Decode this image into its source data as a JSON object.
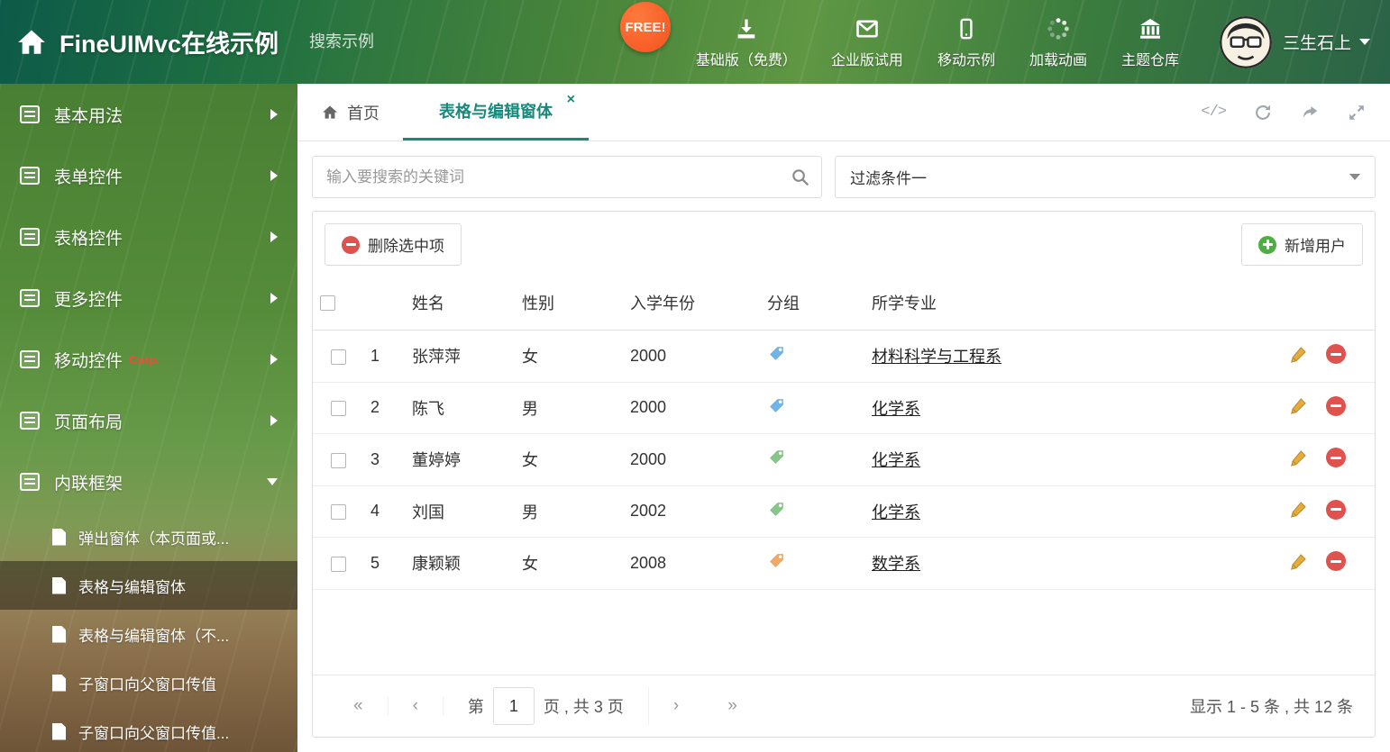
{
  "colors": {
    "accent_teal": "#18897a",
    "header_green": "#3a7b3e",
    "tag_blue": "#6fb5e8",
    "tag_green": "#85c785",
    "tag_orange": "#f2a963",
    "danger_red": "#e0524e",
    "success_green": "#4fae41",
    "free_badge_orange": "#f4511e"
  },
  "header": {
    "title": "FineUIMvc在线示例",
    "search_placeholder": "搜索示例",
    "free_badge": "FREE!",
    "nav": [
      {
        "icon": "download-icon",
        "label": "基础版（免费）"
      },
      {
        "icon": "mail-icon",
        "label": "企业版试用"
      },
      {
        "icon": "mobile-icon",
        "label": "移动示例"
      },
      {
        "icon": "spinner-icon",
        "label": "加载动画"
      },
      {
        "icon": "bank-icon",
        "label": "主题仓库"
      }
    ],
    "user_name": "三生石上"
  },
  "sidebar": {
    "items": [
      {
        "label": "基本用法",
        "icon": "home-icon",
        "state": "collapsed",
        "badge": ""
      },
      {
        "label": "表单控件",
        "icon": "form-icon",
        "state": "collapsed",
        "badge": ""
      },
      {
        "label": "表格控件",
        "icon": "grid-icon",
        "state": "collapsed",
        "badge": ""
      },
      {
        "label": "更多控件",
        "icon": "widgets-icon",
        "state": "collapsed",
        "badge": ""
      },
      {
        "label": "移动控件",
        "icon": "mobile-icon",
        "state": "collapsed",
        "badge": "Corp."
      },
      {
        "label": "页面布局",
        "icon": "layout-icon",
        "state": "collapsed",
        "badge": ""
      },
      {
        "label": "内联框架",
        "icon": "iframe-icon",
        "state": "expanded",
        "badge": ""
      }
    ],
    "subitems": [
      {
        "label": "弹出窗体（本页面或...",
        "state": "normal"
      },
      {
        "label": "表格与编辑窗体",
        "state": "active"
      },
      {
        "label": "表格与编辑窗体（不...",
        "state": "normal"
      },
      {
        "label": "子窗口向父窗口传值",
        "state": "normal"
      },
      {
        "label": "子窗口向父窗口传值...",
        "state": "normal"
      }
    ]
  },
  "tabs": {
    "home_label": "首页",
    "active_label": "表格与编辑窗体",
    "close_glyph": "×"
  },
  "filter_bar": {
    "search_placeholder": "输入要搜索的关键词",
    "filter_selected": "过滤条件一"
  },
  "toolbar": {
    "delete_label": "删除选中项",
    "add_label": "新增用户"
  },
  "table": {
    "headers": {
      "name": "姓名",
      "gender": "性别",
      "year": "入学年份",
      "group": "分组",
      "major": "所学专业"
    },
    "rows": [
      {
        "index": "1",
        "name": "张萍萍",
        "gender": "女",
        "year": "2000",
        "tag": "tag-blue",
        "major": "材料科学与工程系"
      },
      {
        "index": "2",
        "name": "陈飞",
        "gender": "男",
        "year": "2000",
        "tag": "tag-blue",
        "major": "化学系"
      },
      {
        "index": "3",
        "name": "董婷婷",
        "gender": "女",
        "year": "2000",
        "tag": "tag-green",
        "major": "化学系"
      },
      {
        "index": "4",
        "name": "刘国",
        "gender": "男",
        "year": "2002",
        "tag": "tag-green",
        "major": "化学系"
      },
      {
        "index": "5",
        "name": "康颖颖",
        "gender": "女",
        "year": "2008",
        "tag": "tag-orange",
        "major": "数学系"
      }
    ]
  },
  "pagination": {
    "first": "«",
    "prev": "‹",
    "next": "›",
    "last": "»",
    "page_prefix": "第",
    "current_page": "1",
    "page_suffix": "页 , 共 3 页",
    "summary": "显示 1 - 5 条 , 共 12 条"
  }
}
